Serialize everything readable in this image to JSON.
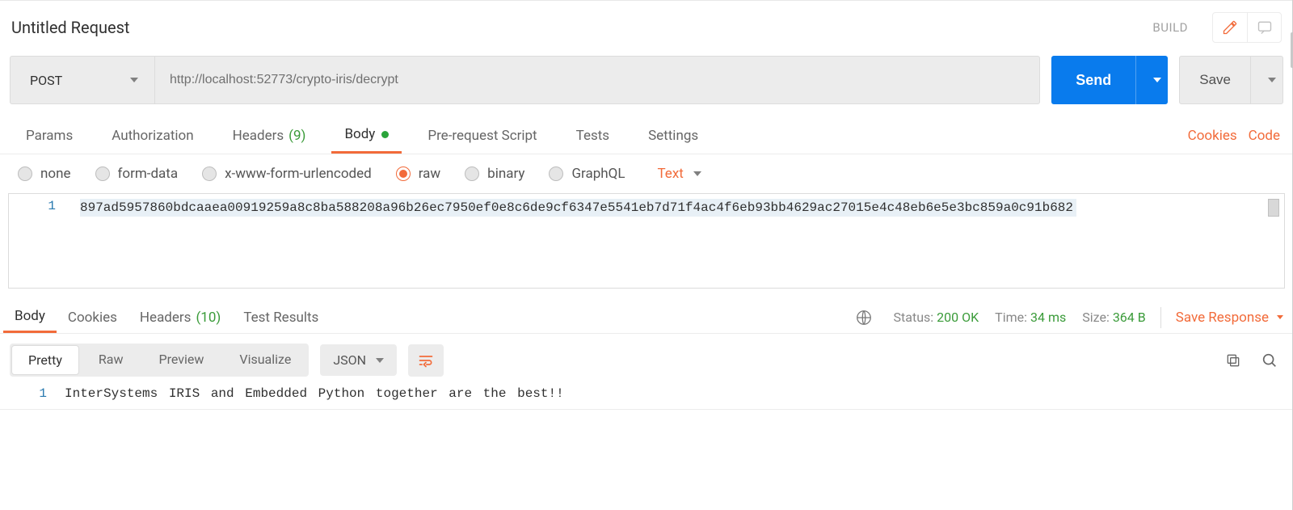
{
  "title": "Untitled Request",
  "buildLabel": "BUILD",
  "method": "POST",
  "url": "http://localhost:52773/crypto-iris/decrypt",
  "sendLabel": "Send",
  "saveLabel": "Save",
  "reqTabs": {
    "params": "Params",
    "authorization": "Authorization",
    "headers": "Headers",
    "headersCount": "(9)",
    "body": "Body",
    "preRequest": "Pre-request Script",
    "tests": "Tests",
    "settings": "Settings"
  },
  "links": {
    "cookies": "Cookies",
    "code": "Code"
  },
  "bodyTypes": {
    "none": "none",
    "formData": "form-data",
    "urlencoded": "x-www-form-urlencoded",
    "raw": "raw",
    "binary": "binary",
    "graphql": "GraphQL"
  },
  "contentType": "Text",
  "requestBody": {
    "lineNo": "1",
    "content": "897ad5957860bdcaaea00919259a8c8ba588208a96b26ec7950ef0e8c6de9cf6347e5541eb7d71f4ac4f6eb93bb4629ac27015e4c48eb6e5e3bc859a0c91b682"
  },
  "respTabs": {
    "body": "Body",
    "cookies": "Cookies",
    "headers": "Headers",
    "headersCount": "(10)",
    "testResults": "Test Results"
  },
  "responseMeta": {
    "statusLabel": "Status:",
    "statusValue": "200 OK",
    "timeLabel": "Time:",
    "timeValue": "34 ms",
    "sizeLabel": "Size:",
    "sizeValue": "364 B"
  },
  "saveResponse": "Save Response",
  "viewModes": {
    "pretty": "Pretty",
    "raw": "Raw",
    "preview": "Preview",
    "visualize": "Visualize"
  },
  "respFormat": "JSON",
  "responseBody": {
    "lineNo": "1",
    "content": "InterSystems IRIS and Embedded Python together are the best!!"
  }
}
